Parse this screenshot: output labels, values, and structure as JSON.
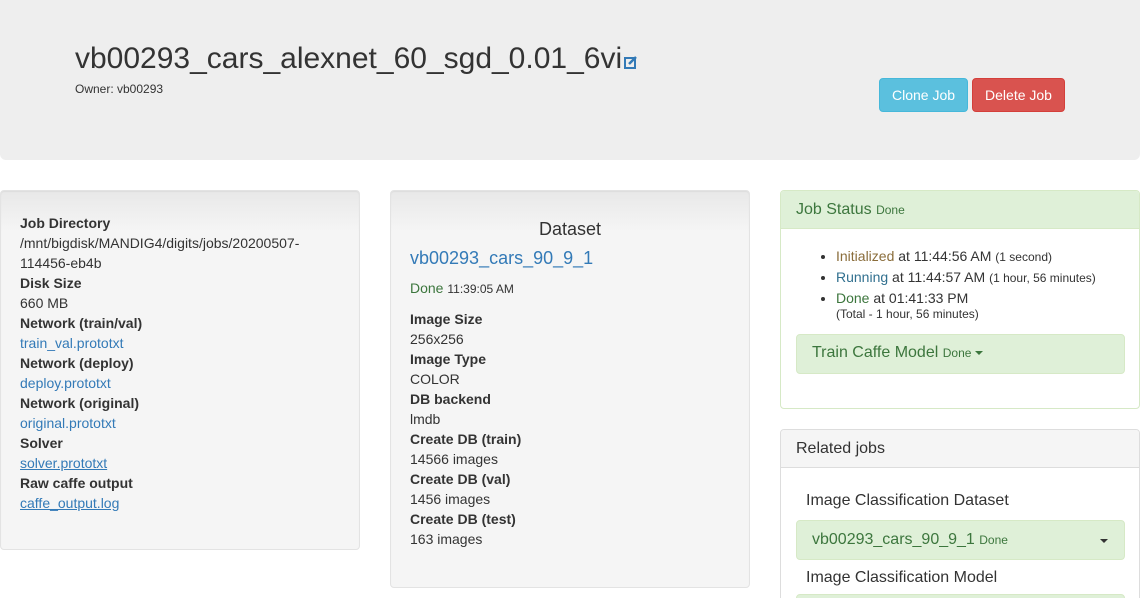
{
  "header": {
    "title": "vb00293_cars_alexnet_60_sgd_0.01_6vi",
    "owner": "Owner: vb00293",
    "clone_label": "Clone Job",
    "delete_label": "Delete Job"
  },
  "job_info": {
    "dir_label": "Job Directory",
    "dir_value": "/mnt/bigdisk/MANDIG4/digits/jobs/20200507-114456-eb4b",
    "disk_label": "Disk Size",
    "disk_value": "660 MB",
    "net_trainval_label": "Network (train/val)",
    "net_trainval_link": "train_val.prototxt",
    "net_deploy_label": "Network (deploy)",
    "net_deploy_link": "deploy.prototxt",
    "net_original_label": "Network (original)",
    "net_original_link": "original.prototxt",
    "solver_label": "Solver",
    "solver_link": "solver.prototxt",
    "raw_label": "Raw caffe output",
    "raw_link": "caffe_output.log"
  },
  "dataset": {
    "heading": "Dataset",
    "name": "vb00293_cars_90_9_1",
    "status": "Done",
    "status_time": "11:39:05 AM",
    "image_size_label": "Image Size",
    "image_size": "256x256",
    "image_type_label": "Image Type",
    "image_type": "COLOR",
    "db_backend_label": "DB backend",
    "db_backend": "lmdb",
    "db_train_label": "Create DB (train)",
    "db_train": "14566 images",
    "db_val_label": "Create DB (val)",
    "db_val": "1456 images",
    "db_test_label": "Create DB (test)",
    "db_test": "163 images"
  },
  "job_status": {
    "title": "Job Status",
    "title_status": "Done",
    "init_label": "Initialized",
    "init_time": "at 11:44:56 AM",
    "init_dur": "(1 second)",
    "run_label": "Running",
    "run_time": "at 11:44:57 AM",
    "run_dur": "(1 hour, 56 minutes)",
    "done_label": "Done",
    "done_time": "at 01:41:33 PM",
    "total": "(Total - 1 hour, 56 minutes)",
    "model_label": "Train Caffe Model",
    "model_status": "Done"
  },
  "related": {
    "title": "Related jobs",
    "dataset_heading": "Image Classification Dataset",
    "dataset_name": "vb00293_cars_90_9_1",
    "dataset_status": "Done",
    "model_heading": "Image Classification Model"
  },
  "icons": {
    "edit": "edit-icon",
    "caret": "caret-down-icon"
  },
  "colors": {
    "primary_link": "#337ab7",
    "success_text": "#3c763d",
    "success_bg": "#dff0d8",
    "info_button": "#5bc0de",
    "danger_button": "#d9534f"
  }
}
